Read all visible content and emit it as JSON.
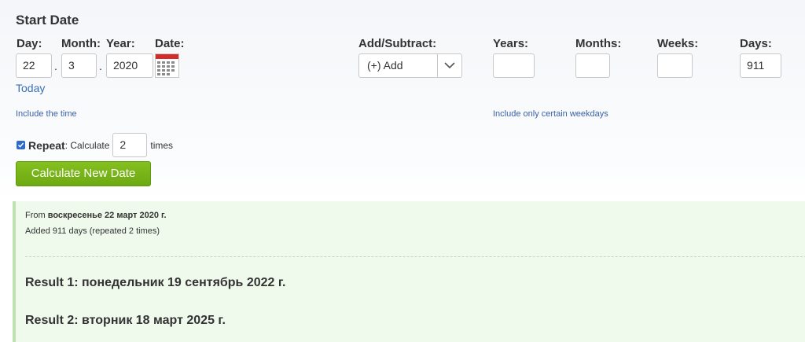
{
  "section_title": "Start Date",
  "fields": {
    "day_label": "Day:",
    "month_label": "Month:",
    "year_label": "Year:",
    "date_label": "Date:",
    "day_value": "22",
    "month_value": "3",
    "year_value": "2020",
    "separator": ".",
    "today_link": "Today"
  },
  "operation": {
    "label": "Add/Subtract:",
    "selected": "(+) Add"
  },
  "amounts": {
    "years_label": "Years:",
    "months_label": "Months:",
    "weeks_label": "Weeks:",
    "days_label": "Days:",
    "years_value": "",
    "months_value": "",
    "weeks_value": "",
    "days_value": "911"
  },
  "links": {
    "include_time": "Include the time",
    "include_weekdays": "Include only certain weekdays"
  },
  "repeat": {
    "label": "Repeat",
    "prefix": ": Calculate",
    "times_value": "2",
    "suffix": "times",
    "checked": true
  },
  "calculate_button": "Calculate New Date",
  "result": {
    "from_prefix": "From ",
    "from_date": "воскресенье 22 март 2020 г.",
    "added_text": "Added 911 days (repeated 2 times)",
    "results": [
      "Result 1: понедельник 19 сентябрь 2022 г.",
      "Result 2: вторник 18 март 2025 г."
    ]
  },
  "colors": {
    "accent_button": "#78b51a",
    "link": "#3a6fb5",
    "result_bg": "#eff9ec",
    "calendar_header": "#d62b2b"
  }
}
